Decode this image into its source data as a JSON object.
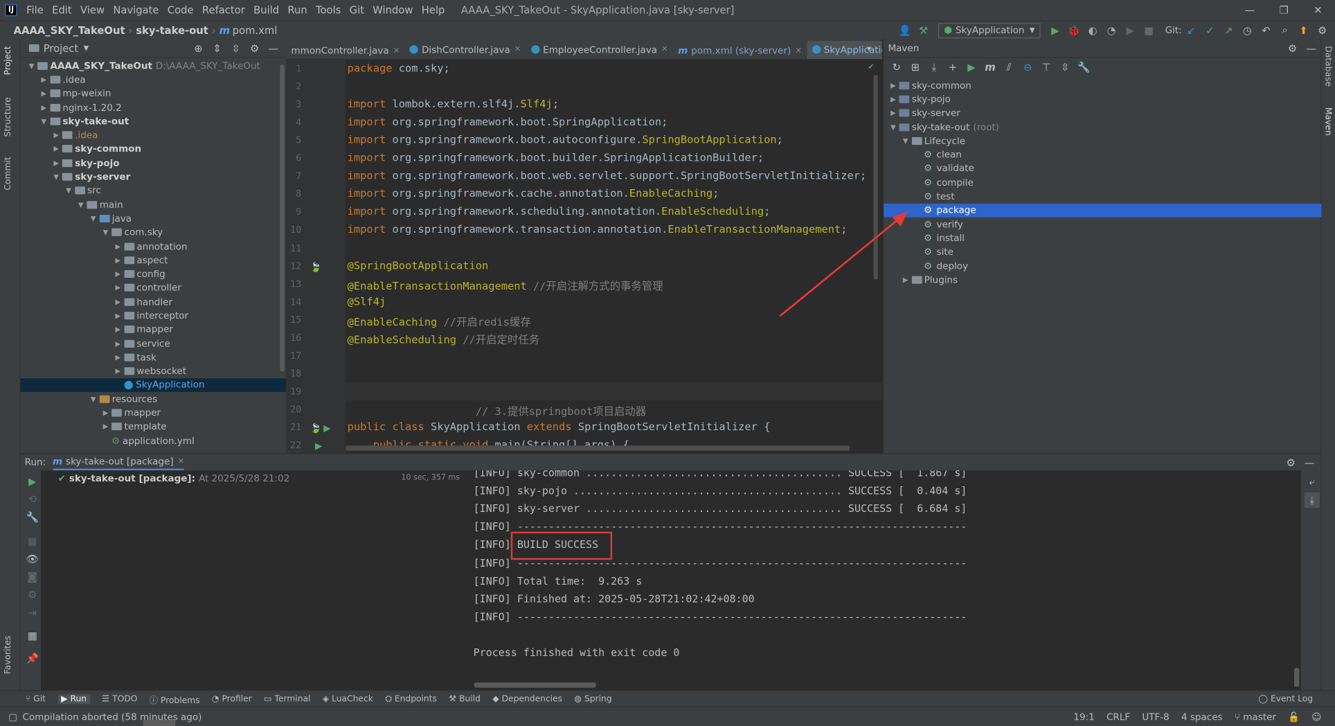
{
  "titlebar": {
    "menu": [
      "File",
      "Edit",
      "View",
      "Navigate",
      "Code",
      "Refactor",
      "Build",
      "Run",
      "Tools",
      "Git",
      "Window",
      "Help"
    ],
    "title": "AAAA_SKY_TakeOut - SkyApplication.java [sky-server]",
    "min": "—",
    "max": "❐",
    "close": "✕"
  },
  "navbar": {
    "crumbs": [
      "AAAA_SKY_TakeOut",
      "sky-take-out",
      "pom.xml"
    ],
    "run_config": "SkyApplication",
    "git_label": "Git:"
  },
  "strips": {
    "left": [
      "Project",
      "Structure",
      "Commit",
      "Favorites"
    ],
    "right": [
      "Database",
      "Maven"
    ]
  },
  "project": {
    "title": "Project",
    "tree": [
      {
        "indent": 0,
        "arrow": "▼",
        "icon": "folder",
        "text": "AAAA_SKY_TakeOut",
        "bold": true,
        "extra": "D:\\AAAA_SKY_TakeOut"
      },
      {
        "indent": 1,
        "arrow": "▶",
        "icon": "folder",
        "text": ".idea"
      },
      {
        "indent": 1,
        "arrow": "▶",
        "icon": "folder",
        "text": "mp-weixin"
      },
      {
        "indent": 1,
        "arrow": "▶",
        "icon": "folder",
        "text": "nginx-1.20.2"
      },
      {
        "indent": 1,
        "arrow": "▼",
        "icon": "folder",
        "text": "sky-take-out",
        "bold": true
      },
      {
        "indent": 2,
        "arrow": "▶",
        "icon": "folder",
        "text": ".idea",
        "orange": true
      },
      {
        "indent": 2,
        "arrow": "▶",
        "icon": "folder",
        "text": "sky-common",
        "bold": true
      },
      {
        "indent": 2,
        "arrow": "▶",
        "icon": "folder",
        "text": "sky-pojo",
        "bold": true
      },
      {
        "indent": 2,
        "arrow": "▼",
        "icon": "folder",
        "text": "sky-server",
        "bold": true
      },
      {
        "indent": 3,
        "arrow": "▼",
        "icon": "folder",
        "text": "src"
      },
      {
        "indent": 4,
        "arrow": "▼",
        "icon": "folder",
        "text": "main"
      },
      {
        "indent": 5,
        "arrow": "▼",
        "icon": "folder-blue",
        "text": "java"
      },
      {
        "indent": 6,
        "arrow": "▼",
        "icon": "folder",
        "text": "com.sky"
      },
      {
        "indent": 7,
        "arrow": "▶",
        "icon": "folder",
        "text": "annotation"
      },
      {
        "indent": 7,
        "arrow": "▶",
        "icon": "folder",
        "text": "aspect"
      },
      {
        "indent": 7,
        "arrow": "▶",
        "icon": "folder",
        "text": "config"
      },
      {
        "indent": 7,
        "arrow": "▶",
        "icon": "folder",
        "text": "controller"
      },
      {
        "indent": 7,
        "arrow": "▶",
        "icon": "folder",
        "text": "handler"
      },
      {
        "indent": 7,
        "arrow": "▶",
        "icon": "folder",
        "text": "interceptor"
      },
      {
        "indent": 7,
        "arrow": "▶",
        "icon": "folder",
        "text": "mapper"
      },
      {
        "indent": 7,
        "arrow": "▶",
        "icon": "folder",
        "text": "service"
      },
      {
        "indent": 7,
        "arrow": "▶",
        "icon": "folder",
        "text": "task"
      },
      {
        "indent": 7,
        "arrow": "▶",
        "icon": "folder",
        "text": "websocket"
      },
      {
        "indent": 7,
        "arrow": "",
        "icon": "class",
        "text": "SkyApplication",
        "selected": true
      },
      {
        "indent": 5,
        "arrow": "▼",
        "icon": "folder-res",
        "text": "resources"
      },
      {
        "indent": 6,
        "arrow": "▶",
        "icon": "folder",
        "text": "mapper"
      },
      {
        "indent": 6,
        "arrow": "▶",
        "icon": "folder",
        "text": "template"
      },
      {
        "indent": 6,
        "arrow": "",
        "icon": "yml",
        "text": "application.yml"
      }
    ]
  },
  "editor": {
    "tabs": [
      {
        "label": "mmonController.java",
        "icon": "class"
      },
      {
        "label": "DishController.java",
        "icon": "class"
      },
      {
        "label": "EmployeeController.java",
        "icon": "class"
      },
      {
        "label": "pom.xml (sky-server)",
        "icon": "maven"
      },
      {
        "label": "SkyApplication.java",
        "icon": "class",
        "active": true
      }
    ],
    "line_numbers": [
      "1",
      "2",
      "3",
      "4",
      "5",
      "6",
      "7",
      "8",
      "9",
      "10",
      "11",
      "12",
      "13",
      "14",
      "15",
      "16",
      "17",
      "18",
      "19",
      "20",
      "21",
      "22"
    ],
    "lines": [
      [
        [
          "kw",
          "package "
        ],
        [
          "p",
          "com.sky;"
        ]
      ],
      [],
      [
        [
          "kw",
          "import "
        ],
        [
          "p",
          "lombok.extern.slf4j."
        ],
        [
          "an",
          "Slf4j"
        ],
        [
          "p",
          ";"
        ]
      ],
      [
        [
          "kw",
          "import "
        ],
        [
          "p",
          "org.springframework.boot.SpringApplication;"
        ]
      ],
      [
        [
          "kw",
          "import "
        ],
        [
          "p",
          "org.springframework.boot.autoconfigure."
        ],
        [
          "an",
          "SpringBootApplication"
        ],
        [
          "p",
          ";"
        ]
      ],
      [
        [
          "kw",
          "import "
        ],
        [
          "p",
          "org.springframework.boot.builder.SpringApplicationBuilder;"
        ]
      ],
      [
        [
          "kw",
          "import "
        ],
        [
          "p",
          "org.springframework.boot.web.servlet.support.SpringBootServletInitializer;"
        ]
      ],
      [
        [
          "kw",
          "import "
        ],
        [
          "p",
          "org.springframework.cache.annotation."
        ],
        [
          "an",
          "EnableCaching"
        ],
        [
          "p",
          ";"
        ]
      ],
      [
        [
          "kw",
          "import "
        ],
        [
          "p",
          "org.springframework.scheduling.annotation."
        ],
        [
          "an",
          "EnableScheduling"
        ],
        [
          "p",
          ";"
        ]
      ],
      [
        [
          "kw",
          "import "
        ],
        [
          "p",
          "org.springframework.transaction.annotation."
        ],
        [
          "an",
          "EnableTransactionManagement"
        ],
        [
          "p",
          ";"
        ]
      ],
      [],
      [
        [
          "an",
          "@SpringBootApplication"
        ]
      ],
      [
        [
          "an",
          "@EnableTransactionManagement "
        ],
        [
          "cm",
          "//开启注解方式的事务管理"
        ]
      ],
      [
        [
          "an",
          "@Slf4j"
        ]
      ],
      [
        [
          "an",
          "@EnableCaching "
        ],
        [
          "cm",
          "//开启redis缓存"
        ]
      ],
      [
        [
          "an",
          "@EnableScheduling "
        ],
        [
          "cm",
          "//开启定时任务"
        ]
      ],
      [],
      [],
      [],
      [
        [
          "cm",
          "                    // 3.提供springboot项目启动器"
        ]
      ],
      [
        [
          "kw",
          "public class "
        ],
        [
          "p",
          "SkyApplication "
        ],
        [
          "kw",
          "extends "
        ],
        [
          "p",
          "SpringBootServletInitializer {"
        ]
      ],
      [
        [
          "kw",
          "    public static void "
        ],
        [
          "p",
          "main(String[] args) {"
        ]
      ]
    ]
  },
  "maven": {
    "title": "Maven",
    "tree": [
      {
        "indent": 0,
        "arrow": "▶",
        "icon": "mod",
        "text": "sky-common"
      },
      {
        "indent": 0,
        "arrow": "▶",
        "icon": "mod",
        "text": "sky-pojo"
      },
      {
        "indent": 0,
        "arrow": "▶",
        "icon": "mod",
        "text": "sky-server"
      },
      {
        "indent": 0,
        "arrow": "▼",
        "icon": "mod",
        "text": "sky-take-out",
        "extra": "(root)"
      },
      {
        "indent": 1,
        "arrow": "▼",
        "icon": "folder",
        "text": "Lifecycle"
      },
      {
        "indent": 2,
        "arrow": "",
        "icon": "gear",
        "text": "clean"
      },
      {
        "indent": 2,
        "arrow": "",
        "icon": "gear",
        "text": "validate"
      },
      {
        "indent": 2,
        "arrow": "",
        "icon": "gear",
        "text": "compile"
      },
      {
        "indent": 2,
        "arrow": "",
        "icon": "gear",
        "text": "test"
      },
      {
        "indent": 2,
        "arrow": "",
        "icon": "gear",
        "text": "package",
        "selected": true
      },
      {
        "indent": 2,
        "arrow": "",
        "icon": "gear",
        "text": "verify"
      },
      {
        "indent": 2,
        "arrow": "",
        "icon": "gear",
        "text": "install"
      },
      {
        "indent": 2,
        "arrow": "",
        "icon": "gear",
        "text": "site"
      },
      {
        "indent": 2,
        "arrow": "",
        "icon": "gear",
        "text": "deploy"
      },
      {
        "indent": 1,
        "arrow": "▶",
        "icon": "folder",
        "text": "Plugins"
      }
    ]
  },
  "run": {
    "label": "Run:",
    "tab": "sky-take-out [package]",
    "item_name": "sky-take-out [package]:",
    "item_time": "At 2025/5/28 21:02",
    "duration": "10 sec, 357 ms",
    "console": [
      "[INFO] sky-common ......................................... SUCCESS [  1.867 s]",
      "[INFO] sky-pojo ........................................... SUCCESS [  0.404 s]",
      "[INFO] sky-server ......................................... SUCCESS [  6.684 s]",
      "[INFO] ------------------------------------------------------------------------",
      "[INFO] BUILD SUCCESS",
      "[INFO] ------------------------------------------------------------------------",
      "[INFO] Total time:  9.263 s",
      "[INFO] Finished at: 2025-05-28T21:02:42+08:00",
      "[INFO] ------------------------------------------------------------------------",
      "",
      "Process finished with exit code 0"
    ]
  },
  "bottom_tools": [
    "Git",
    "Run",
    "TODO",
    "Problems",
    "Profiler",
    "Terminal",
    "LuaCheck",
    "Endpoints",
    "Build",
    "Dependencies",
    "Spring"
  ],
  "event_log": "Event Log",
  "status": {
    "message": "Compilation aborted (58 minutes ago)",
    "position": "19:1",
    "line_sep": "CRLF",
    "encoding": "UTF-8",
    "indent": "4 spaces",
    "branch": "master"
  }
}
